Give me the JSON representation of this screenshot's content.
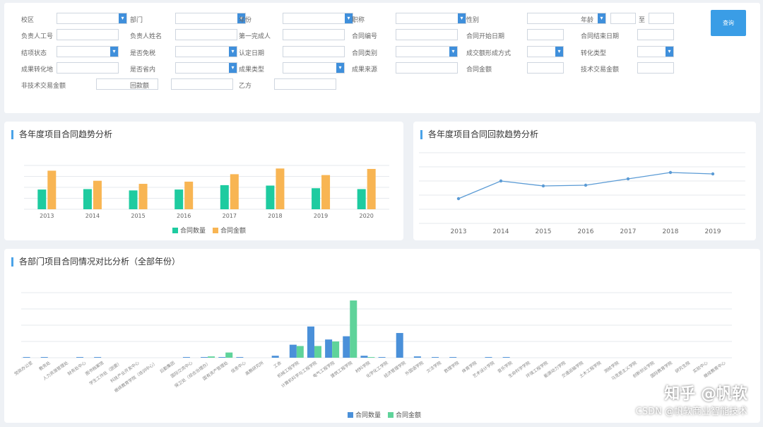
{
  "filters": {
    "row1": [
      {
        "label": "校区",
        "type": "select"
      },
      {
        "label": "部门",
        "type": "select"
      },
      {
        "label": "年份",
        "type": "select"
      },
      {
        "label": "职称",
        "type": "select"
      },
      {
        "label": "性别",
        "type": "select"
      },
      {
        "label": "年龄",
        "type": "range",
        "to": "至"
      }
    ],
    "row2": [
      {
        "label": "负责人工号",
        "type": "text"
      },
      {
        "label": "负责人姓名",
        "type": "text"
      },
      {
        "label": "第一完成人",
        "type": "text"
      },
      {
        "label": "合同编号",
        "type": "text"
      },
      {
        "label": "合同开始日期",
        "type": "text"
      },
      {
        "label": "合同结束日期",
        "type": "text"
      }
    ],
    "row3": [
      {
        "label": "结项状态",
        "type": "select"
      },
      {
        "label": "是否免税",
        "type": "select"
      },
      {
        "label": "认定日期",
        "type": "text"
      },
      {
        "label": "合同类别",
        "type": "select"
      },
      {
        "label": "成交额形成方式",
        "type": "select"
      },
      {
        "label": "转化类型",
        "type": "select"
      }
    ],
    "row4": [
      {
        "label": "成果转化地",
        "type": "text"
      },
      {
        "label": "是否省内",
        "type": "select"
      },
      {
        "label": "成果类型",
        "type": "select"
      },
      {
        "label": "成果来源",
        "type": "text"
      },
      {
        "label": "合同金额",
        "type": "text"
      },
      {
        "label": "技术交易金额",
        "type": "text"
      }
    ],
    "row5": [
      {
        "label": "非技术交易金额",
        "type": "text"
      },
      {
        "label": "回款额",
        "type": "text"
      },
      {
        "label": "乙方",
        "type": "text"
      }
    ],
    "query_label": "查询"
  },
  "chart1_title": "各年度项目合同趋势分析",
  "chart2_title": "各年度项目合同回款趋势分析",
  "chart3_title": "各部门项目合同情况对比分析（全部年份）",
  "legend": {
    "count": "合同数量",
    "amount": "合同金额"
  },
  "watermark": {
    "line1": "知乎 @帆软",
    "line2": "CSDN @帆软商业智能技术"
  },
  "colors": {
    "count_bar": "#1ecba0",
    "amount_bar": "#f8b553",
    "line": "#5b9bd5",
    "dept_count": "#4a90d9",
    "dept_amount": "#5fd39a",
    "accent": "#4aa3e8"
  },
  "chart_data": [
    {
      "type": "bar",
      "title": "各年度项目合同趋势分析",
      "categories": [
        "2013",
        "2014",
        "2015",
        "2016",
        "2017",
        "2018",
        "2019",
        "2020"
      ],
      "series": [
        {
          "name": "合同数量",
          "values": [
            45,
            46,
            43,
            45,
            55,
            54,
            48,
            46
          ]
        },
        {
          "name": "合同金额",
          "values": [
            88,
            65,
            58,
            63,
            80,
            93,
            78,
            92
          ]
        }
      ],
      "ylim": [
        0,
        100
      ]
    },
    {
      "type": "line",
      "title": "各年度项目合同回款趋势分析",
      "x": [
        "2013",
        "2014",
        "2015",
        "2016",
        "2017",
        "2018",
        "2019"
      ],
      "series": [
        {
          "values": [
            35,
            60,
            53,
            54,
            63,
            72,
            70
          ]
        }
      ],
      "ylim": [
        0,
        100
      ]
    },
    {
      "type": "bar",
      "title": "各部门项目合同情况对比分析（全部年份）",
      "categories": [
        "党政办公室",
        "教务处",
        "人力资源管理处",
        "财务处中心",
        "图书档案馆",
        "学生工作处（团委）",
        "科技产业开发中心",
        "继续教育学院（培训中心）",
        "后勤集团",
        "国际交流中心",
        "保卫处（综合治理办）",
        "国有资产管理处",
        "信息中心",
        "高教研究所",
        "工会",
        "机械工程学院",
        "计算机科学与工程学院",
        "电气工程学院",
        "建筑工程学院",
        "材料学院",
        "化学化工学院",
        "经济管理学院",
        "外国语学院",
        "文法学院",
        "数理学院",
        "体育学院",
        "艺术设计学院",
        "音乐学院",
        "生命科学学院",
        "环境工程学院",
        "能源动力学院",
        "交通运输学院",
        "土木工程学院",
        "测绘学院",
        "马克思主义学院",
        "创新创业学院",
        "国际教育学院",
        "研究生院",
        "实验中心",
        "继续教育中心"
      ],
      "series": [
        {
          "name": "合同数量",
          "values": [
            1,
            1,
            0,
            1,
            1,
            0,
            0,
            0,
            0,
            1,
            1,
            1,
            1,
            0,
            3,
            20,
            48,
            28,
            33,
            3,
            1,
            38,
            2,
            1,
            1,
            0,
            1,
            1,
            0,
            0,
            0,
            0,
            0,
            0,
            0,
            0,
            0,
            0,
            0,
            0
          ]
        },
        {
          "name": "合同金额",
          "values": [
            0,
            0,
            0,
            0,
            0,
            0,
            0,
            0,
            0,
            0,
            2,
            8,
            0,
            0,
            0,
            18,
            18,
            25,
            88,
            1,
            0,
            0,
            0,
            0,
            0,
            0,
            0,
            0,
            0,
            0,
            0,
            0,
            0,
            0,
            0,
            0,
            0,
            0,
            0,
            0
          ]
        }
      ],
      "ylim": [
        0,
        100
      ]
    }
  ]
}
